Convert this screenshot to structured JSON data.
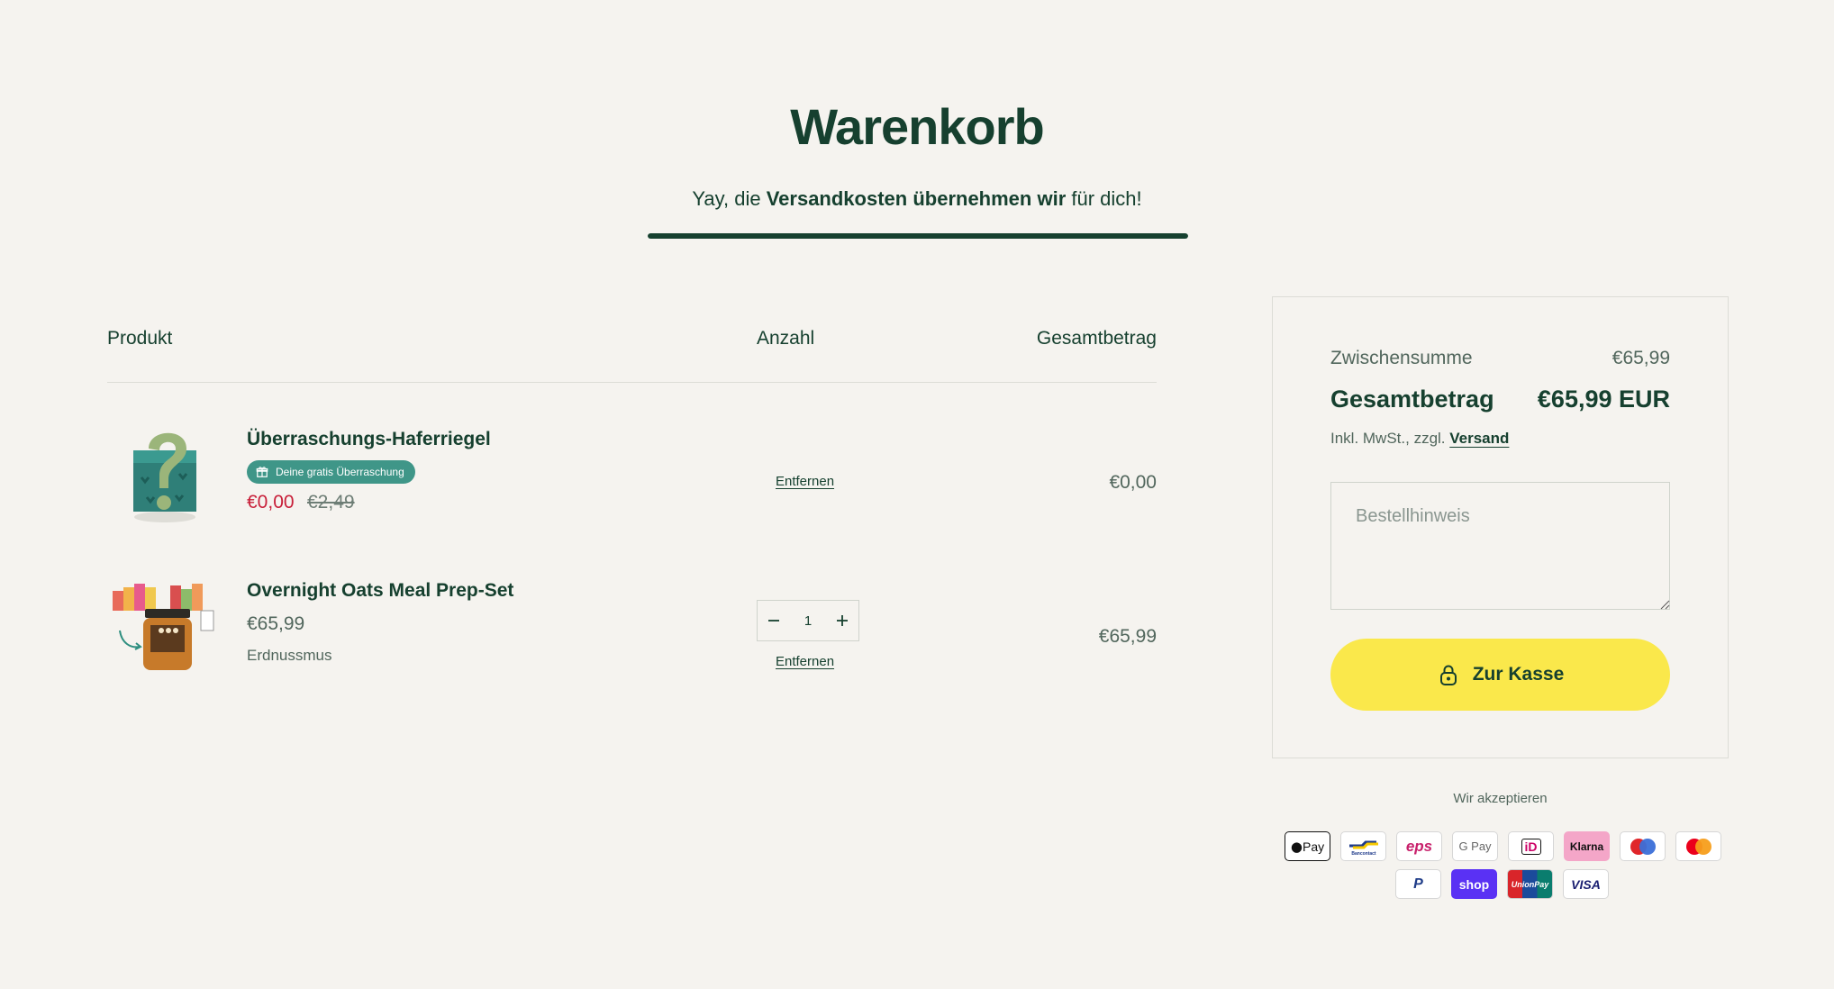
{
  "page": {
    "title": "Warenkorb",
    "shipping_message": {
      "prefix": "Yay, die ",
      "bold": "Versandkosten übernehmen wir",
      "suffix": " für dich!"
    },
    "shipping_progress": 1.0
  },
  "table": {
    "col_product": "Produkt",
    "col_quantity": "Anzahl",
    "col_total": "Gesamtbetrag"
  },
  "items": [
    {
      "name": "Überraschungs-Haferriegel",
      "badge": "Deine gratis Überraschung",
      "price": "€0,00",
      "compare_price": "€2,49",
      "remove_label": "Entfernen",
      "line_total": "€0,00"
    },
    {
      "name": "Overnight Oats Meal Prep-Set",
      "price": "€65,99",
      "variant": "Erdnussmus",
      "quantity": "1",
      "remove_label": "Entfernen",
      "line_total": "€65,99"
    }
  ],
  "summary": {
    "subtotal_label": "Zwischensumme",
    "subtotal_value": "€65,99",
    "total_label": "Gesamtbetrag",
    "total_value": "€65,99 EUR",
    "tax_note": "Inkl. MwSt., zzgl. ",
    "shipping_link": "Versand",
    "note_placeholder": "Bestellhinweis",
    "checkout_label": "Zur Kasse"
  },
  "payments": {
    "label": "Wir akzeptieren",
    "row1": [
      "Pay",
      "Bancontact",
      "eps",
      "G Pay",
      "iD",
      "Klarna",
      "Maestro",
      "Mastercard"
    ],
    "row2": [
      "PayPal",
      "shop",
      "UnionPay",
      "VISA"
    ]
  },
  "colors": {
    "background": "#f5f3ef",
    "primary": "#16402f",
    "sale": "#c8203a",
    "badge": "#3f9688",
    "checkout": "#fae84b"
  }
}
